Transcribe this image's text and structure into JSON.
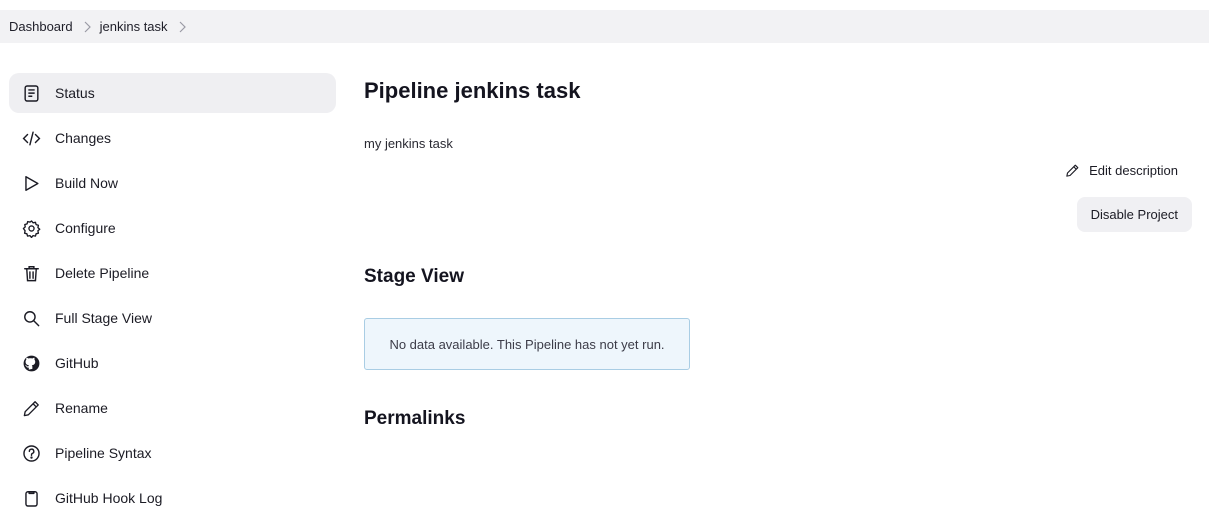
{
  "breadcrumb": [
    "Dashboard",
    "jenkins task"
  ],
  "sidebar": {
    "items": [
      {
        "label": "Status",
        "icon": "document-icon",
        "active": true
      },
      {
        "label": "Changes",
        "icon": "code-icon"
      },
      {
        "label": "Build Now",
        "icon": "play-icon"
      },
      {
        "label": "Configure",
        "icon": "gear-icon"
      },
      {
        "label": "Delete Pipeline",
        "icon": "trash-icon"
      },
      {
        "label": "Full Stage View",
        "icon": "search-icon"
      },
      {
        "label": "GitHub",
        "icon": "github-icon"
      },
      {
        "label": "Rename",
        "icon": "pencil-icon"
      },
      {
        "label": "Pipeline Syntax",
        "icon": "help-icon"
      },
      {
        "label": "GitHub Hook Log",
        "icon": "clipboard-icon"
      }
    ]
  },
  "main": {
    "title": "Pipeline jenkins task",
    "description": "my jenkins task",
    "edit_description_label": "Edit description",
    "disable_button_label": "Disable Project",
    "stage_view_title": "Stage View",
    "no_data_message": "No data available. This Pipeline has not yet run.",
    "permalinks_title": "Permalinks"
  },
  "colors": {
    "breadcrumb_bg": "#f2f2f4",
    "active_item_bg": "#efeff2",
    "info_border": "#a9cde4",
    "info_bg": "#eef6fc"
  }
}
